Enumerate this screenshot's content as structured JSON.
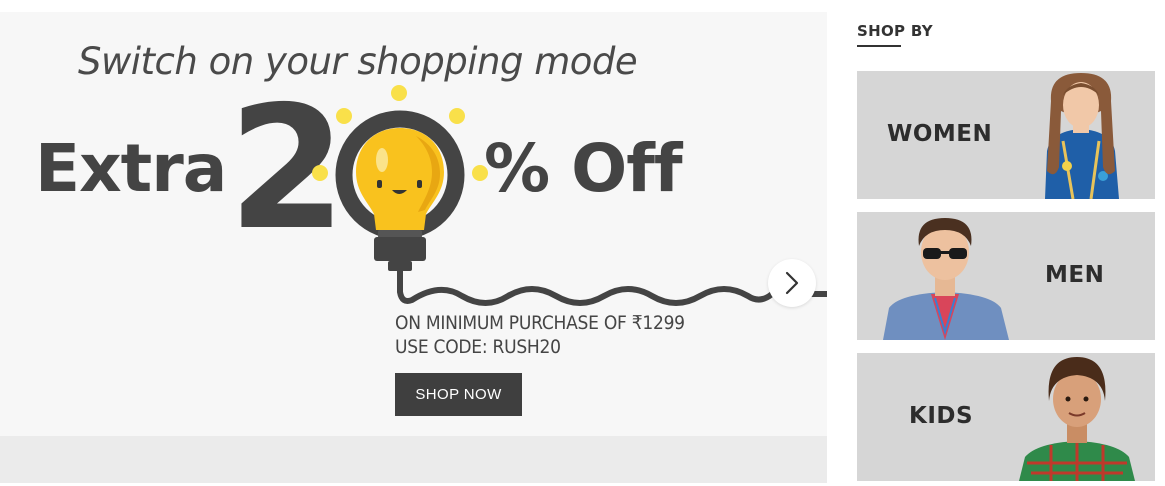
{
  "banner": {
    "tagline": "Switch on your shopping mode",
    "extra_word": "Extra",
    "digit_two": "2",
    "off_word": "% Off",
    "offer_line_1": "ON MINIMUM PURCHASE OF ₹1299",
    "offer_line_2": "USE CODE: RUSH20",
    "shop_now_label": "SHOP NOW",
    "next_icon": "chevron-right-icon"
  },
  "shop_by": {
    "title": "SHOP BY",
    "categories": [
      {
        "label": "WOMEN"
      },
      {
        "label": "MEN"
      },
      {
        "label": "KIDS"
      }
    ]
  },
  "colors": {
    "text_dark": "#444444",
    "bulb_yellow": "#f9c21e",
    "button_bg": "#3f3f3f",
    "card_bg": "#d6d6d6",
    "page_bg": "#ffffff"
  }
}
